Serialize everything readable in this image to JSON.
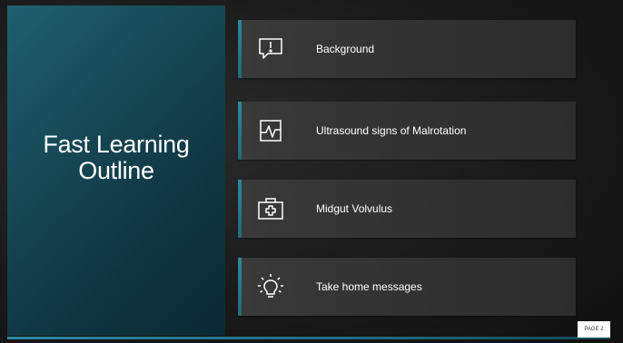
{
  "slide": {
    "title_line1": "Fast Learning",
    "title_line2": "Outline",
    "page_label": "PAGE 2"
  },
  "items": [
    {
      "label": "Background",
      "icon": "speech-bubble-exclamation-icon"
    },
    {
      "label": "Ultrasound signs of Malrotation",
      "icon": "heart-rate-monitor-icon"
    },
    {
      "label": "Midgut Volvulus",
      "icon": "first-aid-kit-icon"
    },
    {
      "label": "Take home messages",
      "icon": "lightbulb-icon"
    }
  ],
  "colors": {
    "accent": "#2a8aa0",
    "panel": "#174956",
    "card": "#333333",
    "text": "#ffffff"
  }
}
